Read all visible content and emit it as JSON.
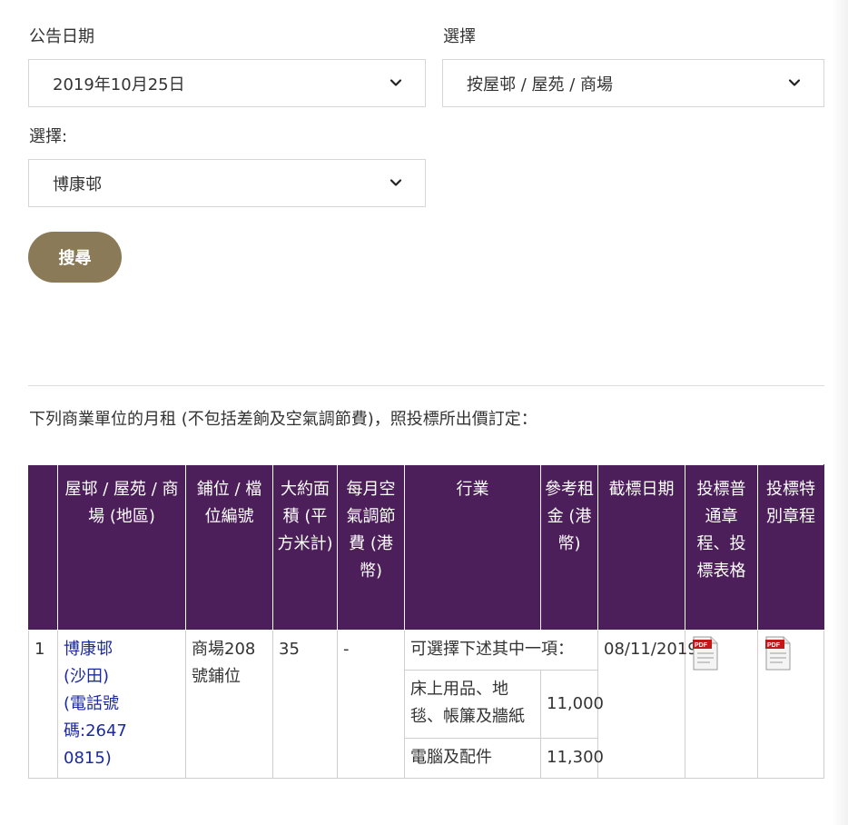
{
  "filters": {
    "date_label": "公告日期",
    "date_value": "2019年10月25日",
    "type_label": "選擇",
    "type_value": "按屋邨 / 屋苑 / 商場",
    "estate_label": "選擇:",
    "estate_value": "博康邨",
    "search_button": "搜尋"
  },
  "intro_text": "下列商業單位的月租 (不包括差餉及空氣調節費)，照投標所出價訂定：",
  "table": {
    "headers": {
      "estate": "屋邨 / 屋苑 / 商場 (地區)",
      "shop": "鋪位 / 檔位編號",
      "area": "大約面積 (平方米計)",
      "ac_fee": "每月空氣調節費 (港幣)",
      "trade": "行業",
      "ref_rent": "參考租金 (港幣)",
      "closing": "截標日期",
      "general": "投標普通章程、投標表格",
      "special": "投標特別章程"
    },
    "rows": [
      {
        "no": "1",
        "estate_name": "博康邨",
        "district": "(沙田)",
        "phone": "(電話號碼:2647 0815)",
        "shop": "商場208號鋪位",
        "area": "35",
        "ac_fee": "-",
        "trade_note": "可選擇下述其中一項：",
        "trades": [
          {
            "name": "床上用品、地毯、帳簾及牆紙",
            "rent": "11,000"
          },
          {
            "name": "電腦及配件",
            "rent": "11,300"
          }
        ],
        "closing_date": "08/11/2019",
        "general_icon": "pdf-icon",
        "special_icon": "pdf-icon"
      }
    ]
  },
  "colors": {
    "header_bg": "#4c1e5a",
    "button_bg": "#8a7a57",
    "link": "#1b2a9e"
  }
}
